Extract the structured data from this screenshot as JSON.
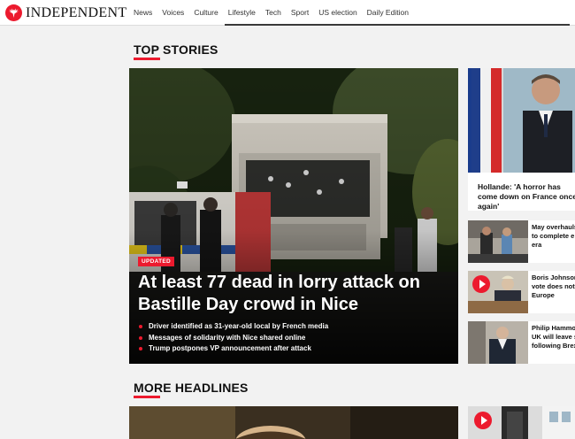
{
  "brand": {
    "name": "INDEPENDENT",
    "logo_icon": "eagle-icon",
    "accent_color": "#ec1a2e"
  },
  "nav": {
    "items": [
      "News",
      "Voices",
      "Culture",
      "Lifestyle",
      "Tech",
      "Sport",
      "US election",
      "Daily Edition"
    ]
  },
  "sections": {
    "top_stories": "TOP STORIES",
    "more_headlines": "MORE HEADLINES"
  },
  "hero": {
    "badge": "UPDATED",
    "headline": "At least 77 dead in lorry attack on Bastille Day crowd in Nice",
    "bullets": [
      "Driver identified as 31-year-old local by French media",
      "Messages of solidarity with Nice shared online",
      "Trump postpones VP announcement after attack"
    ]
  },
  "side": {
    "main": "Hollande: 'A horror has come down on France once again'",
    "items": [
      {
        "lines": [
          "May overhauls",
          "to complete e",
          "era"
        ],
        "video": false
      },
      {
        "lines": [
          "Boris Johnson",
          "vote does not",
          "Europe"
        ],
        "video": true
      },
      {
        "lines": [
          "Philip Hammo",
          "UK will leave s",
          "following Brex"
        ],
        "video": false
      }
    ]
  }
}
